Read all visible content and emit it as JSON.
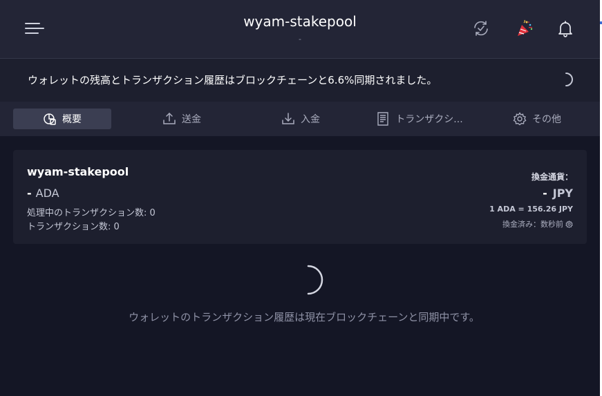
{
  "topbar": {
    "wallet_name": "wyam-stakepool",
    "wallet_subtitle": "-",
    "icons": [
      "menu-icon",
      "sync-status-icon",
      "celebration-icon",
      "bell-icon"
    ]
  },
  "banner": {
    "message": "ウォレットの残高とトランザクション履歴はブロックチェーンと6.6%同期されました。",
    "sync_percent": 6.6
  },
  "tabs": [
    {
      "label": "概要",
      "icon": "summary-icon",
      "active": true
    },
    {
      "label": "送金",
      "icon": "upload-icon",
      "active": false
    },
    {
      "label": "入金",
      "icon": "download-icon",
      "active": false
    },
    {
      "label": "トランザクシ...",
      "icon": "receipt-icon",
      "active": false
    },
    {
      "label": "その他",
      "icon": "gear-icon",
      "active": false
    }
  ],
  "summary": {
    "wallet_name": "wyam-stakepool",
    "ada_amount": "-",
    "ada_unit": "ADA",
    "pending_label": "処理中のトランザクション数: 0",
    "tx_count_label": "トランザクション数: 0",
    "conversion_label": "換金通貨：",
    "conversion_amount": "-",
    "conversion_unit": "JPY",
    "rate": "1 ADA = 156.26 JPY",
    "last_updated": "換金済み：数秒前"
  },
  "main": {
    "sync_message": "ウォレットのトランザクション履歴は現在ブロックチェーンと同期中です。"
  },
  "colors": {
    "background": "#141625",
    "topbar": "#232536",
    "card": "#1d1f2e",
    "active_tab": "#3b3e52",
    "party_red": "#e0323c"
  }
}
